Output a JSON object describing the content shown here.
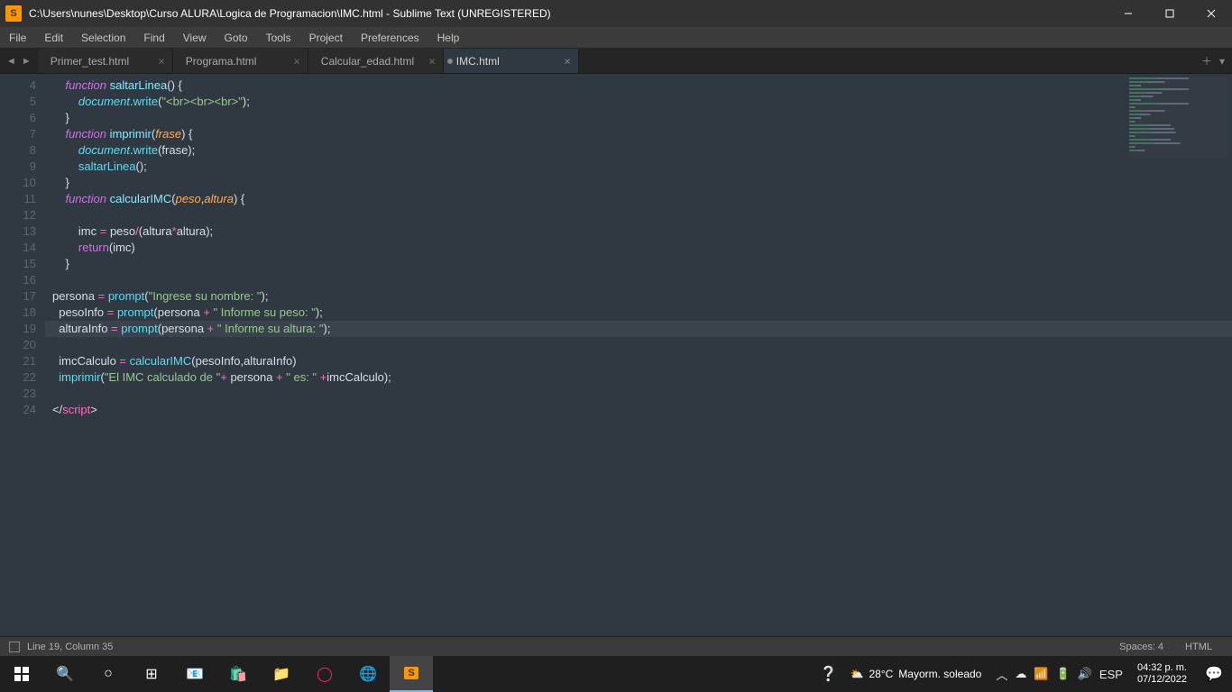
{
  "titlebar": {
    "icon_letter": "S",
    "title": "C:\\Users\\nunes\\Desktop\\Curso ALURA\\Logica de Programacion\\IMC.html - Sublime Text (UNREGISTERED)"
  },
  "menubar": {
    "items": [
      "File",
      "Edit",
      "Selection",
      "Find",
      "View",
      "Goto",
      "Tools",
      "Project",
      "Preferences",
      "Help"
    ]
  },
  "tabs": {
    "items": [
      {
        "label": "Primer_test.html",
        "active": false
      },
      {
        "label": "Programa.html",
        "active": false
      },
      {
        "label": "Calcular_edad.html",
        "active": false
      },
      {
        "label": "IMC.html",
        "active": true,
        "modified": true
      }
    ]
  },
  "gutter": {
    "start": 4,
    "end": 24,
    "modified_lines": [
      19,
      21,
      22
    ]
  },
  "code": {
    "current_line": 19,
    "tokens": [
      [
        [
          "    ",
          "p"
        ],
        [
          "function",
          "storage"
        ],
        [
          " ",
          "p"
        ],
        [
          "saltarLinea",
          "func"
        ],
        [
          "() {",
          "p"
        ]
      ],
      [
        [
          "        ",
          "p"
        ],
        [
          "document",
          "obj"
        ],
        [
          ".",
          "p"
        ],
        [
          "write",
          "call"
        ],
        [
          "(",
          "p"
        ],
        [
          "\"<br><br><br>\"",
          "str"
        ],
        [
          ");",
          "p"
        ]
      ],
      [
        [
          "    }",
          "p"
        ]
      ],
      [
        [
          "    ",
          "p"
        ],
        [
          "function",
          "storage"
        ],
        [
          " ",
          "p"
        ],
        [
          "imprimir",
          "func"
        ],
        [
          "(",
          "p"
        ],
        [
          "frase",
          "param"
        ],
        [
          ") {",
          "p"
        ]
      ],
      [
        [
          "        ",
          "p"
        ],
        [
          "document",
          "obj"
        ],
        [
          ".",
          "p"
        ],
        [
          "write",
          "call"
        ],
        [
          "(frase);",
          "p"
        ]
      ],
      [
        [
          "        ",
          "p"
        ],
        [
          "saltarLinea",
          "call"
        ],
        [
          "();",
          "p"
        ]
      ],
      [
        [
          "    }",
          "p"
        ]
      ],
      [
        [
          "    ",
          "p"
        ],
        [
          "function",
          "storage"
        ],
        [
          " ",
          "p"
        ],
        [
          "calcularIMC",
          "func"
        ],
        [
          "(",
          "p"
        ],
        [
          "peso",
          "param"
        ],
        [
          ",",
          "p"
        ],
        [
          "altura",
          "param"
        ],
        [
          ") {",
          "p"
        ]
      ],
      [
        [
          "",
          "p"
        ]
      ],
      [
        [
          "        imc ",
          "p"
        ],
        [
          "=",
          "op"
        ],
        [
          " peso",
          "p"
        ],
        [
          "/",
          "op"
        ],
        [
          "(altura",
          "p"
        ],
        [
          "*",
          "op"
        ],
        [
          "altura);",
          "p"
        ]
      ],
      [
        [
          "        ",
          "p"
        ],
        [
          "return",
          "return"
        ],
        [
          "(imc)",
          "p"
        ]
      ],
      [
        [
          "    }",
          "p"
        ]
      ],
      [
        [
          "",
          "p"
        ]
      ],
      [
        [
          "persona ",
          "p"
        ],
        [
          "=",
          "op"
        ],
        [
          " ",
          "p"
        ],
        [
          "prompt",
          "call"
        ],
        [
          "(",
          "p"
        ],
        [
          "\"Ingrese su nombre: \"",
          "str"
        ],
        [
          ");",
          "p"
        ]
      ],
      [
        [
          "  pesoInfo ",
          "p"
        ],
        [
          "=",
          "op"
        ],
        [
          " ",
          "p"
        ],
        [
          "prompt",
          "call"
        ],
        [
          "(persona ",
          "p"
        ],
        [
          "+",
          "op"
        ],
        [
          " ",
          "p"
        ],
        [
          "\" Informe su peso: \"",
          "str"
        ],
        [
          ");",
          "p"
        ]
      ],
      [
        [
          "  alturaInfo ",
          "p"
        ],
        [
          "=",
          "op"
        ],
        [
          " ",
          "p"
        ],
        [
          "prompt",
          "call"
        ],
        [
          "(persona ",
          "p"
        ],
        [
          "+",
          "op"
        ],
        [
          " ",
          "p"
        ],
        [
          "\" Informe su altura: \"",
          "str"
        ],
        [
          ");",
          "p"
        ]
      ],
      [
        [
          "",
          "p"
        ]
      ],
      [
        [
          "  imcCalculo ",
          "p"
        ],
        [
          "=",
          "op"
        ],
        [
          " ",
          "p"
        ],
        [
          "calcularIMC",
          "call"
        ],
        [
          "(pesoInfo,alturaInfo)",
          "p"
        ]
      ],
      [
        [
          "  ",
          "p"
        ],
        [
          "imprimir",
          "call"
        ],
        [
          "(",
          "p"
        ],
        [
          "\"El IMC calculado de \"",
          "str"
        ],
        [
          "+",
          "op"
        ],
        [
          " persona ",
          "p"
        ],
        [
          "+",
          "op"
        ],
        [
          " ",
          "p"
        ],
        [
          "\" es: \"",
          "str"
        ],
        [
          " ",
          "p"
        ],
        [
          "+",
          "op"
        ],
        [
          "imcCalculo);",
          "p"
        ]
      ],
      [
        [
          "",
          "p"
        ]
      ],
      [
        [
          "</",
          "p"
        ],
        [
          "script",
          "tag"
        ],
        [
          ">",
          "p"
        ]
      ]
    ]
  },
  "statusbar": {
    "position": "Line 19, Column 35",
    "spaces": "Spaces: 4",
    "syntax": "HTML"
  },
  "taskbar": {
    "weather_temp": "28°C",
    "weather_text": "Mayorm. soleado",
    "lang": "ESP",
    "time": "04:32 p. m.",
    "date": "07/12/2022"
  }
}
